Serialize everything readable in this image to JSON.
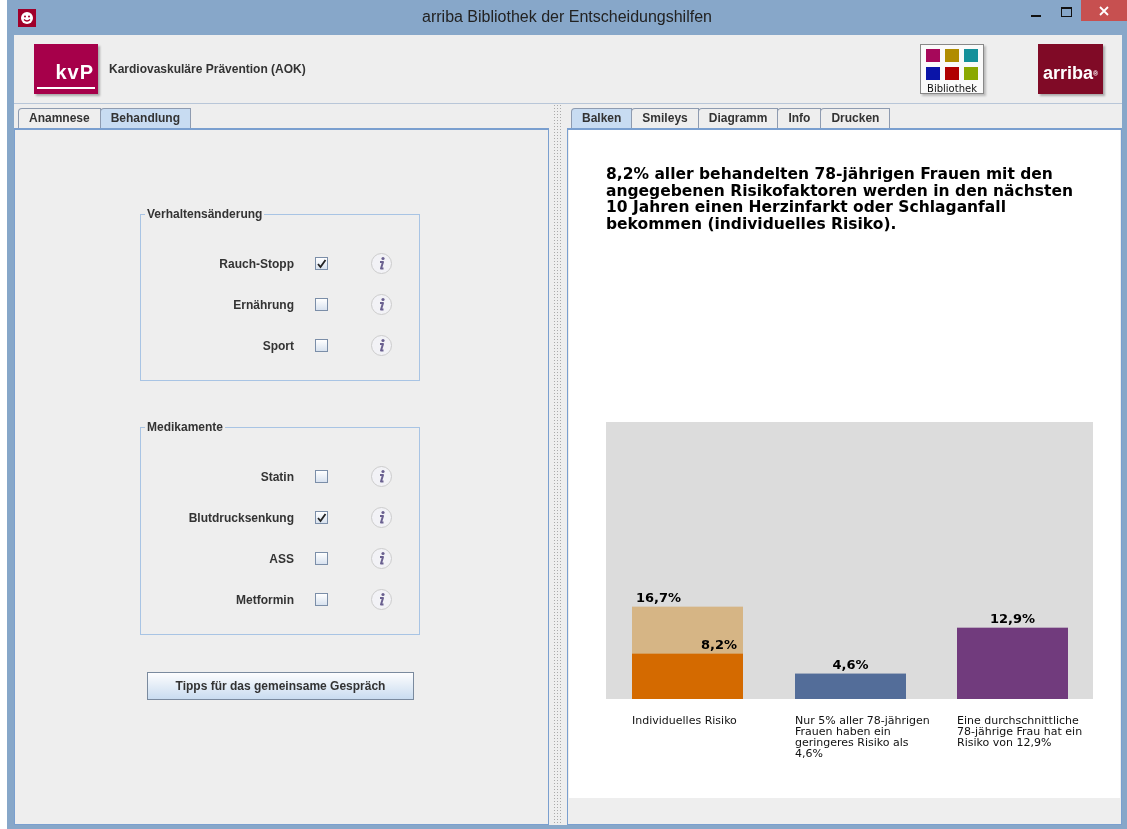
{
  "window": {
    "title": "arriba Bibliothek der Entscheidungshilfen"
  },
  "header": {
    "kvp_logo": "kvP",
    "module_title": "Kardiovaskuläre Prävention (AOK)",
    "library_logo": "Bibliothek",
    "arriba_logo": "arriba$^{®}$"
  },
  "left_tabs": [
    {
      "label": "Anamnese",
      "selected": false
    },
    {
      "label": "Behandlung",
      "selected": true
    }
  ],
  "groups": [
    {
      "title": "Verhaltensänderung",
      "items": [
        {
          "label": "Rauch-Stopp",
          "checked": true
        },
        {
          "label": "Ernährung",
          "checked": false
        },
        {
          "label": "Sport",
          "checked": false
        }
      ]
    },
    {
      "title": "Medikamente",
      "items": [
        {
          "label": "Statin",
          "checked": false
        },
        {
          "label": "Blutdrucksenkung",
          "checked": true
        },
        {
          "label": "ASS",
          "checked": false
        },
        {
          "label": "Metformin",
          "checked": false
        }
      ]
    }
  ],
  "tips_button": "Tipps für das gemeinsame Gespräch",
  "right_tabs": [
    {
      "label": "Balken",
      "selected": true
    },
    {
      "label": "Smileys",
      "selected": false
    },
    {
      "label": "Diagramm",
      "selected": false
    },
    {
      "label": "Info",
      "selected": false
    },
    {
      "label": "Drucken",
      "selected": false
    }
  ],
  "headline": "8,2% aller behandelten 78-jährigen Frauen mit den angegebenen Risikofaktoren werden in den nächsten 10 Jahren einen Herzinfarkt oder Schlaganfall bekommen (individuelles Risiko).",
  "chart_data": {
    "type": "bar",
    "stacked": false,
    "categories": [
      "Individuelles Risiko",
      "Nur 5% aller 78-jährigen Frauen haben ein geringeres Risiko als 4,6%",
      "Eine durchschnittliche 78-jährige Frau hat ein Risiko von 12,9%"
    ],
    "series": [
      {
        "color": "#d6b585",
        "values": [
          16.7,
          null,
          null
        ],
        "value_labels": [
          "16,7%",
          null,
          null
        ]
      },
      {
        "color": "#d46a00",
        "values": [
          8.2,
          null,
          null
        ],
        "value_labels": [
          "8,2%",
          null,
          null
        ]
      },
      {
        "color": "#536d99",
        "values": [
          null,
          4.6,
          null
        ],
        "value_labels": [
          null,
          "4,6%",
          null
        ]
      },
      {
        "color": "#713b7d",
        "values": [
          null,
          null,
          12.9
        ],
        "value_labels": [
          null,
          null,
          "12,9%"
        ]
      }
    ]
  }
}
